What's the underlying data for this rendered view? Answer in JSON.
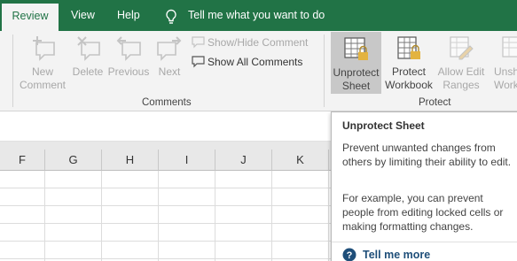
{
  "tabs": {
    "review": "Review",
    "view": "View",
    "help": "Help",
    "tell_me": "Tell me what you want to do"
  },
  "ribbon": {
    "comments": {
      "new_comment": "New\nComment",
      "delete": "Delete",
      "previous": "Previous",
      "next": "Next",
      "show_hide_comment": "Show/Hide Comment",
      "show_all_comments": "Show All Comments",
      "group_label": "Comments"
    },
    "protect": {
      "unprotect_sheet": "Unprotect\nSheet",
      "protect_workbook": "Protect\nWorkbook",
      "allow_edit_ranges": "Allow Edit\nRanges",
      "unshare_workbook": "Unsh\nWork",
      "group_label": "Protect"
    }
  },
  "columns": [
    "F",
    "G",
    "H",
    "I",
    "J",
    "K"
  ],
  "tooltip": {
    "title": "Unprotect Sheet",
    "para1": "Prevent unwanted changes from others by limiting their ability to edit.",
    "para2": "For example, you can prevent people from editing locked cells or making formatting changes.",
    "tell_me_more": "Tell me more"
  },
  "colors": {
    "accent": "#217346",
    "ribbon_bg": "#f3f3f3",
    "disabled_text": "#a8a8a8",
    "link": "#1e4e79"
  }
}
